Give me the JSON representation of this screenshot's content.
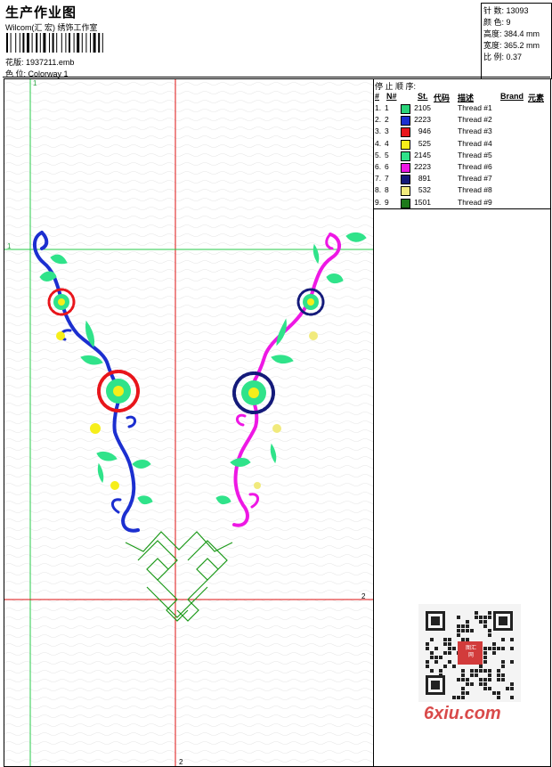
{
  "header": {
    "title": "生产作业图",
    "company": "Wilcom(汇 宏) 绣饰工作室",
    "design_label": "花版:",
    "design_value": "1937211.emb",
    "color_label": "色 位:",
    "color_value": "Colorway 1"
  },
  "stats": [
    {
      "label": "针 数:",
      "value": "13093"
    },
    {
      "label": "颜 色:",
      "value": "9"
    },
    {
      "label": "高度:",
      "value": "384.4 mm"
    },
    {
      "label": "宽度:",
      "value": "365.2 mm"
    },
    {
      "label": "比 例:",
      "value": "0.37"
    }
  ],
  "stop_sequence": {
    "title": "停 止 顺 序:",
    "columns": [
      "#",
      "N#",
      "St.",
      "代码",
      "描述",
      "Brand",
      "元素"
    ],
    "rows": [
      {
        "n": "1.",
        "nn": "1",
        "code": "2105",
        "color": "#2bd47a",
        "desc": "Thread #1"
      },
      {
        "n": "2.",
        "nn": "2",
        "code": "2223",
        "color": "#1c2fd0",
        "desc": "Thread #2"
      },
      {
        "n": "3.",
        "nn": "3",
        "code": "946",
        "color": "#e8151b",
        "desc": "Thread #3"
      },
      {
        "n": "4.",
        "nn": "4",
        "code": "525",
        "color": "#f6ee1a",
        "desc": "Thread #4"
      },
      {
        "n": "5.",
        "nn": "5",
        "code": "2145",
        "color": "#30e38a",
        "desc": "Thread #5"
      },
      {
        "n": "6.",
        "nn": "6",
        "code": "2223",
        "color": "#ee18e4",
        "desc": "Thread #6"
      },
      {
        "n": "7.",
        "nn": "7",
        "code": "891",
        "color": "#141a7a",
        "desc": "Thread #7"
      },
      {
        "n": "8.",
        "nn": "8",
        "code": "532",
        "color": "#f1ea7c",
        "desc": "Thread #8"
      },
      {
        "n": "9.",
        "nn": "9",
        "code": "1501",
        "color": "#1d7a1a",
        "desc": "Thread #9"
      }
    ]
  },
  "guides": {
    "v1": "1",
    "v2": "2",
    "h1": "1",
    "h2": "2"
  },
  "watermark": {
    "text": "6xiu.com",
    "seal": "图汇网"
  }
}
